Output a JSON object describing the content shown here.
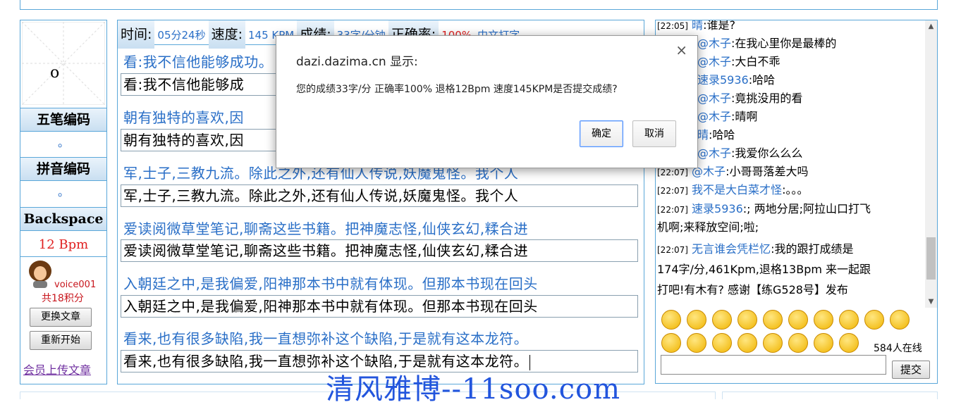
{
  "left": {
    "current_char": "o",
    "wubi_label": "五笔编码",
    "wubi_value": "。",
    "pinyin_label": "拼音编码",
    "pinyin_value": "。",
    "backspace_label": "Backspace",
    "backspace_value": "12 Bpm",
    "username": "voice001",
    "points": "共18积分",
    "change_article": "更换文章",
    "restart": "重新开始",
    "upload_link": "会员上传文章"
  },
  "stats": {
    "time_label": "时间:",
    "time_value": "05分24秒",
    "speed_label": "速度:",
    "speed_value": "145 KPM",
    "score_label": "成绩:",
    "score_value": "33字/分钟",
    "accuracy_label": "正确率:",
    "accuracy_value": "100%",
    "mode_value": "中文打字"
  },
  "lines": [
    {
      "orig": "看:我不信他能够成功。",
      "typed": "看:我不信他能够成"
    },
    {
      "orig": "朝有独特的喜欢,因",
      "typed": "朝有独特的喜欢,因"
    },
    {
      "orig": "军,士子,三教九流。除此之外,还有仙人传说,妖魔鬼怪。我个人",
      "typed": "军,士子,三教九流。除此之外,还有仙人传说,妖魔鬼怪。我个人"
    },
    {
      "orig": "爱读阅微草堂笔记,聊斋这些书籍。把神魔志怪,仙侠玄幻,糅合进",
      "typed": "爱读阅微草堂笔记,聊斋这些书籍。把神魔志怪,仙侠玄幻,糅合进"
    },
    {
      "orig": "入朝廷之中,是我偏爱,阳神那本书中就有体现。但那本书现在回头",
      "typed": "入朝廷之中,是我偏爱,阳神那本书中就有体现。但那本书现在回头"
    },
    {
      "orig": "看来,也有很多缺陷,我一直想弥补这个缺陷,于是就有这本龙符。",
      "typed": "看来,也有很多缺陷,我一直想弥补这个缺陷,于是就有这本龙符。"
    }
  ],
  "chat": {
    "messages": [
      {
        "ts": "[22:05]",
        "name": "晴",
        "text": ":谁是?"
      },
      {
        "ts": "",
        "name": "@木子",
        "text": ":在我心里你是最棒的"
      },
      {
        "ts": "",
        "name": "@木子",
        "text": ":大白不乖"
      },
      {
        "ts": "",
        "name": "速录5936",
        "text": ":哈哈"
      },
      {
        "ts": "",
        "name": "@木子",
        "text": ":竟挑没用的看"
      },
      {
        "ts": "",
        "name": "@木子",
        "text": ":晴啊"
      },
      {
        "ts": "",
        "name": "晴",
        "text": ":哈哈"
      },
      {
        "ts": "",
        "name": "@木子",
        "text": ":我爱你么么么"
      },
      {
        "ts": "[22:07]",
        "name": "@木子",
        "text": ":小哥哥落差大吗"
      },
      {
        "ts": "[22:07]",
        "name": "我不是大白菜才怪",
        "text": ":。。。"
      },
      {
        "ts": "[22:07]",
        "name": "速录5936",
        "text": ":; 两地分居;阿拉山口打飞"
      },
      {
        "ts": "",
        "name": "",
        "text": "机啊;来释放空间;啦;"
      },
      {
        "ts": "[22:07]",
        "name": "无言谁会凭栏忆",
        "text": ":我的跟打成绩是"
      },
      {
        "ts": "",
        "name": "",
        "text": "174字/分,461Kpm,退格13Bpm 来一起跟"
      },
      {
        "ts": "",
        "name": "",
        "text": "打吧!有木有? 感谢【练G528号】发布"
      }
    ],
    "online": "584人在线",
    "submit": "提交"
  },
  "dialog": {
    "title": "dazi.dazima.cn 显示:",
    "message": "您的成绩33字/分 正确率100% 退格12Bpm 速度145KPM是否提交成绩?",
    "ok": "确定",
    "cancel": "取消"
  },
  "watermark": "清风雅博--11soo.com"
}
